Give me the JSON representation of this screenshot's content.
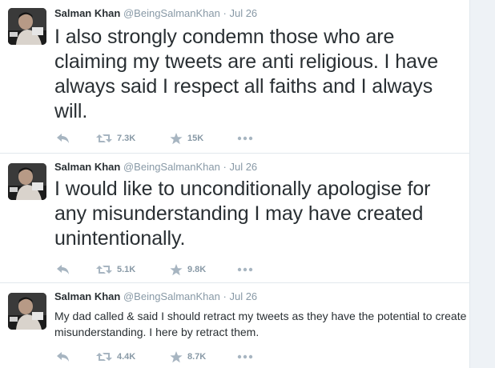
{
  "tweets": [
    {
      "author_name": "Salman Khan",
      "handle": "@BeingSalmanKhan",
      "separator": "·",
      "date": "Jul 26",
      "text": "I also strongly condemn those who are claiming my tweets are anti religious. I have always said I respect all faiths and I always will.",
      "retweets": "7.3K",
      "favorites": "15K"
    },
    {
      "author_name": "Salman Khan",
      "handle": "@BeingSalmanKhan",
      "separator": "·",
      "date": "Jul 26",
      "text": "I would like to unconditionally apologise for any misunderstanding I may have created unintentionally.",
      "retweets": "5.1K",
      "favorites": "9.8K"
    },
    {
      "author_name": "Salman Khan",
      "handle": "@BeingSalmanKhan",
      "separator": "·",
      "date": "Jul 26",
      "text": "My dad called & said I should retract my tweets as they have the potential to create misunderstanding. I here by retract them.",
      "retweets": "4.4K",
      "favorites": "8.7K"
    }
  ],
  "icons": {
    "reply": "reply-icon",
    "retweet": "retweet-icon",
    "favorite": "star-icon",
    "more": "more-dots-icon"
  },
  "colors": {
    "text": "#292f33",
    "muted": "#8899a6",
    "divider": "#e1e8ed"
  }
}
